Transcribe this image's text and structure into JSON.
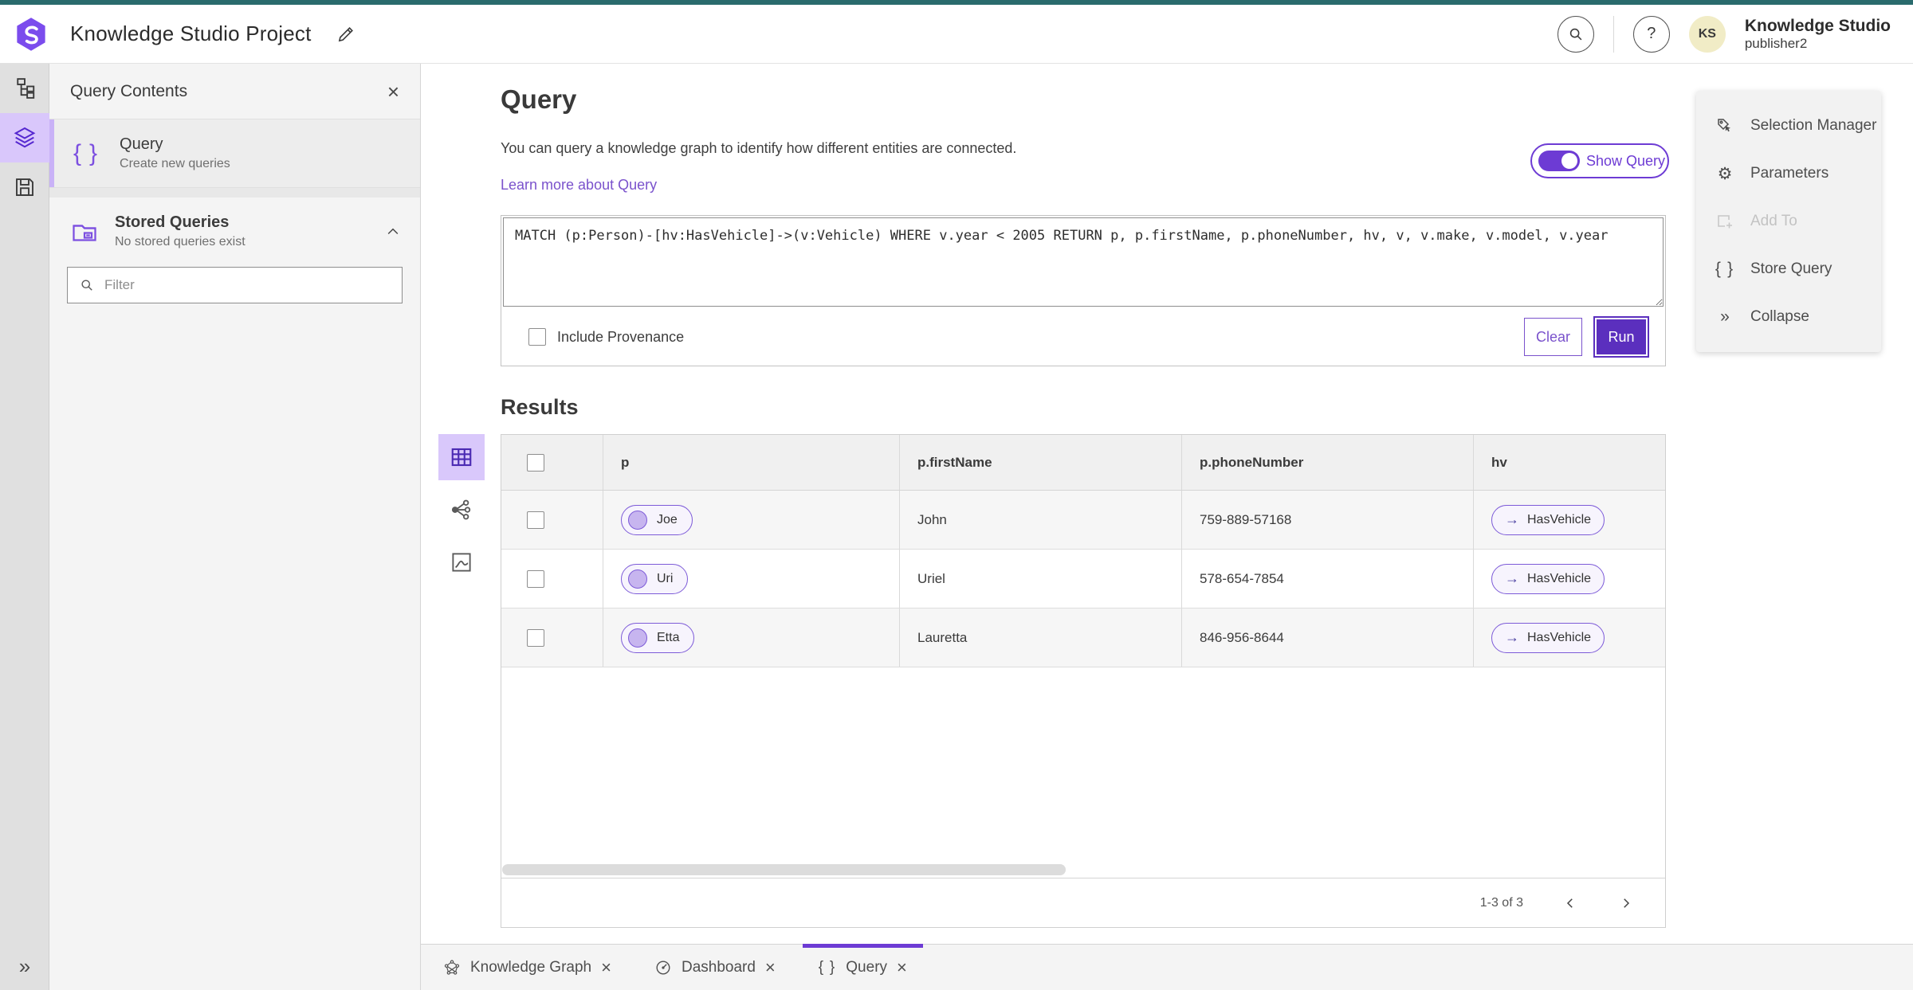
{
  "topbar": {
    "title": "Knowledge Studio Project",
    "product_name": "Knowledge Studio",
    "user_name": "publisher2",
    "avatar_initials": "KS",
    "icons": [
      "app-logo",
      "edit-pencil-icon",
      "search-icon",
      "help-icon"
    ]
  },
  "left_rail": {
    "items": [
      {
        "icon": "hierarchy-icon",
        "selected": false
      },
      {
        "icon": "layers-icon",
        "selected": true
      },
      {
        "icon": "save-icon",
        "selected": false
      }
    ],
    "expand_icon": "double-chevron-right-icon"
  },
  "sidebar": {
    "title": "Query Contents",
    "close_icon": "close-icon",
    "query_item": {
      "icon": "braces-icon",
      "title": "Query",
      "subtitle": "Create new queries"
    },
    "stored": {
      "icon": "stored-queries-folder-icon",
      "title": "Stored Queries",
      "subtitle": "No stored queries exist",
      "collapse_icon": "chevron-up-icon"
    },
    "filter_placeholder": "Filter"
  },
  "main": {
    "title": "Query",
    "description": "You can query a knowledge graph to identify how different entities are connected.",
    "learn_more": "Learn more about Query",
    "show_query_label": "Show Query",
    "show_query_on": true,
    "query_text": "MATCH (p:Person)-[hv:HasVehicle]->(v:Vehicle) WHERE v.year < 2005 RETURN p, p.firstName, p.phoneNumber, hv, v, v.make, v.model, v.year",
    "include_provenance_label": "Include Provenance",
    "include_provenance_checked": false,
    "clear_label": "Clear",
    "run_label": "Run",
    "results_title": "Results",
    "view_toolbar": [
      {
        "icon": "table-view-icon",
        "selected": true
      },
      {
        "icon": "graph-view-icon",
        "selected": false
      },
      {
        "icon": "chart-view-icon",
        "selected": false
      }
    ]
  },
  "table": {
    "columns": [
      "p",
      "p.firstName",
      "p.phoneNumber",
      "hv"
    ],
    "rows": [
      {
        "p": "Joe",
        "firstName": "John",
        "phoneNumber": "759-889-57168",
        "hv": "HasVehicle"
      },
      {
        "p": "Uri",
        "firstName": "Uriel",
        "phoneNumber": "578-654-7854",
        "hv": "HasVehicle"
      },
      {
        "p": "Etta",
        "firstName": "Lauretta",
        "phoneNumber": "846-956-8644",
        "hv": "HasVehicle"
      }
    ],
    "pagination": "1-3 of 3"
  },
  "right_panel": {
    "items": [
      {
        "icon": "selection-manager-icon",
        "label": "Selection Manager",
        "disabled": false
      },
      {
        "icon": "gear-icon",
        "label": "Parameters",
        "disabled": false
      },
      {
        "icon": "add-to-icon",
        "label": "Add To",
        "disabled": true
      },
      {
        "icon": "braces-icon",
        "label": "Store Query",
        "disabled": false
      },
      {
        "icon": "double-chevron-right-icon",
        "label": "Collapse",
        "disabled": false
      }
    ]
  },
  "bottom_tabs": [
    {
      "icon": "knowledge-graph-icon",
      "label": "Knowledge Graph",
      "active": false
    },
    {
      "icon": "dashboard-gauge-icon",
      "label": "Dashboard",
      "active": false
    },
    {
      "icon": "braces-icon",
      "label": "Query",
      "active": true
    }
  ],
  "colors": {
    "accent_purple": "#6d3bd4",
    "run_button_purple": "#5b2fbe",
    "link_purple": "#7a52cc",
    "selected_lavender": "#d9c7fb",
    "pill_border": "#7d5bd8",
    "pill_fill": "#f7f4fd",
    "teal_strip": "#2a6b6d",
    "avatar_yellow": "#f1ecc6"
  }
}
